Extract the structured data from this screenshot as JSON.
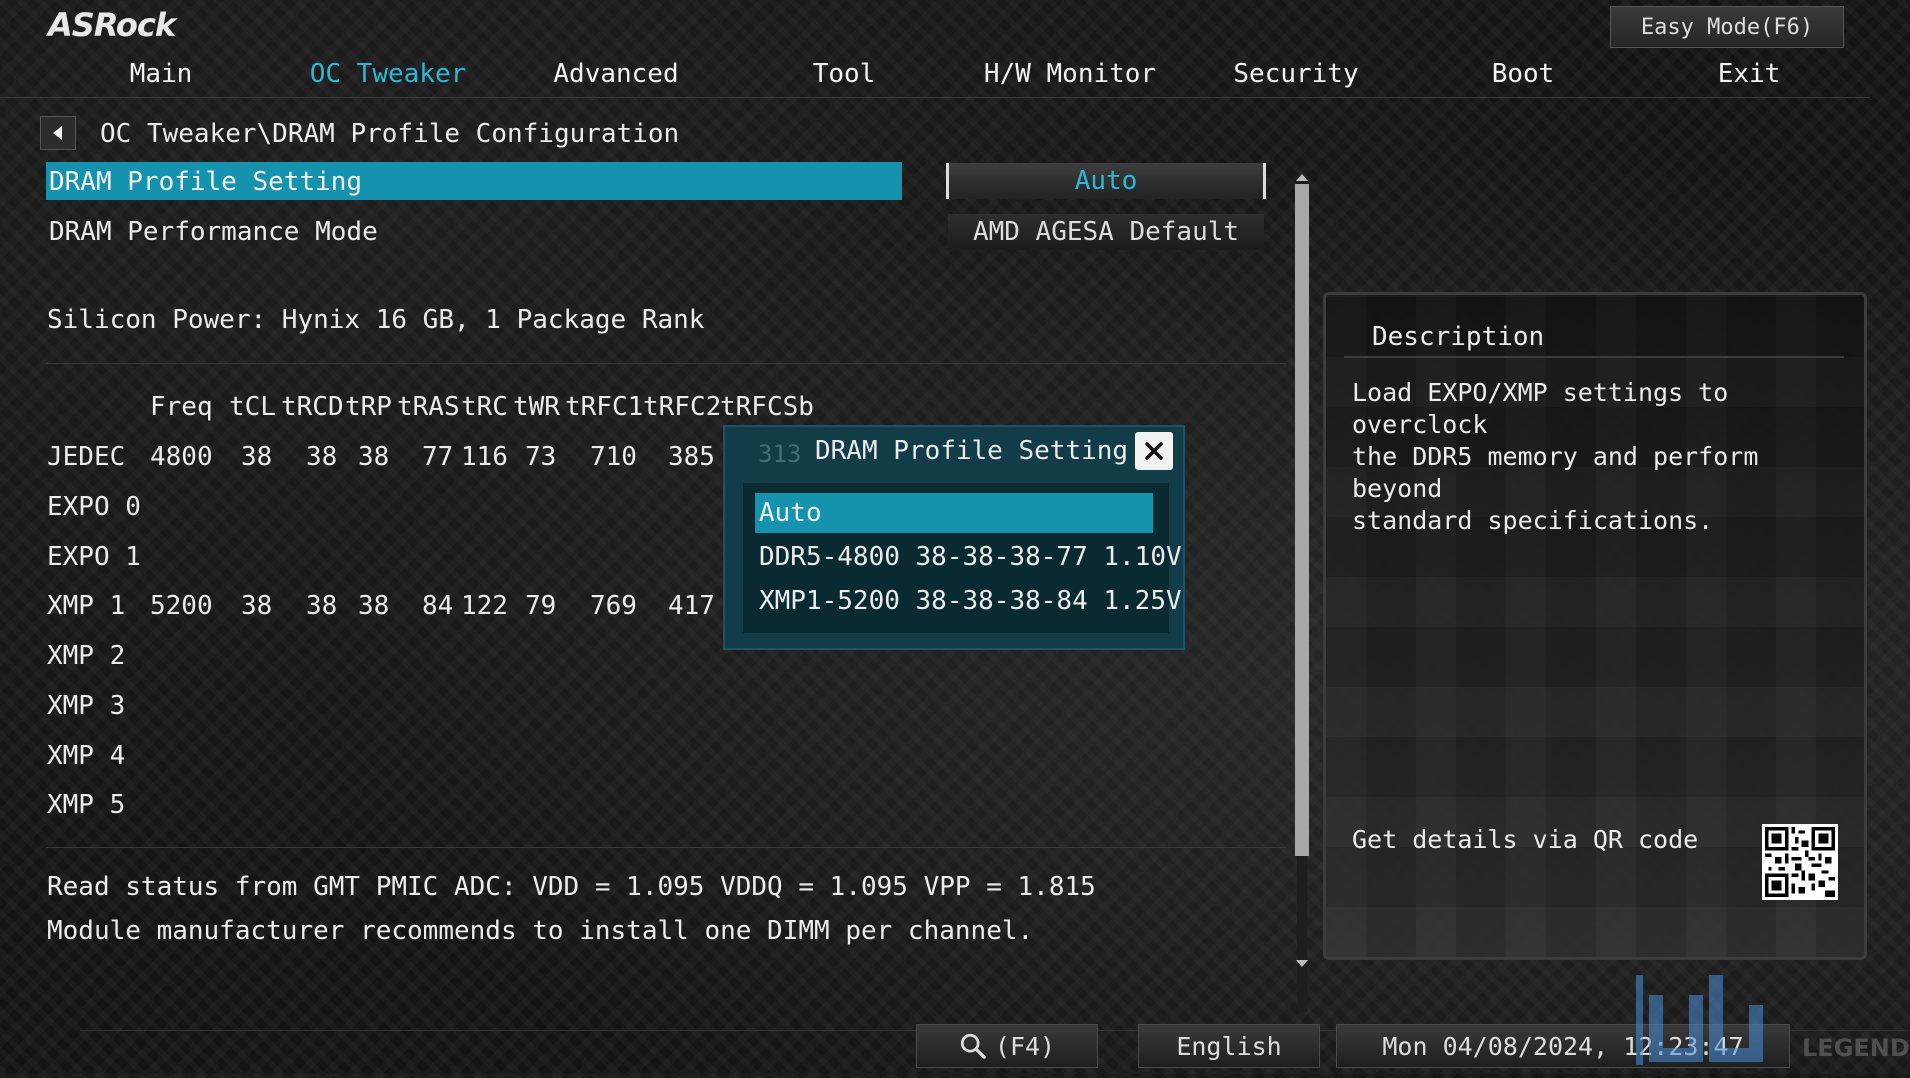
{
  "header": {
    "logo": "ASRock",
    "easy_mode": "Easy Mode(F6)"
  },
  "tabs": [
    {
      "label": "Main"
    },
    {
      "label": "OC Tweaker",
      "active": true
    },
    {
      "label": "Advanced"
    },
    {
      "label": "Tool"
    },
    {
      "label": "H/W Monitor"
    },
    {
      "label": "Security"
    },
    {
      "label": "Boot"
    },
    {
      "label": "Exit"
    }
  ],
  "breadcrumb": "OC Tweaker\\DRAM Profile Configuration",
  "settings": [
    {
      "label": "DRAM Profile Setting",
      "value": "Auto"
    },
    {
      "label": "DRAM Performance Mode",
      "value": "AMD AGESA Default"
    }
  ],
  "module_info": "Silicon Power: Hynix 16 GB, 1 Package Rank",
  "timings": {
    "headers": [
      "Freq",
      "tCL",
      "tRCD",
      "tRP",
      "tRAS",
      "tRC",
      "tWR",
      "tRFC1",
      "tRFC2",
      "tRFCSb"
    ],
    "rows": [
      {
        "name": "JEDEC",
        "values": [
          "4800",
          "38",
          "38",
          "38",
          "77",
          "116",
          "73",
          "710",
          "385",
          "313"
        ]
      },
      {
        "name": "EXPO 0",
        "values": []
      },
      {
        "name": "EXPO 1",
        "values": []
      },
      {
        "name": "XMP 1",
        "values": [
          "5200",
          "38",
          "38",
          "38",
          "84",
          "122",
          "79",
          "769",
          "417",
          ""
        ]
      },
      {
        "name": "XMP 2",
        "values": []
      },
      {
        "name": "XMP 3",
        "values": []
      },
      {
        "name": "XMP 4",
        "values": []
      },
      {
        "name": "XMP 5",
        "values": []
      }
    ]
  },
  "status": {
    "line1": "Read status from GMT PMIC ADC: VDD = 1.095 VDDQ = 1.095 VPP = 1.815",
    "line2": "Module manufacturer recommends to install one DIMM per channel."
  },
  "modal": {
    "title": "DRAM Profile Setting",
    "options": [
      "Auto",
      "DDR5-4800 38-38-38-77 1.10V",
      "XMP1-5200 38-38-38-84 1.25V"
    ],
    "selected_index": 0
  },
  "description": {
    "title": "Description",
    "text": "Load EXPO/XMP settings to overclock\nthe DDR5 memory and perform beyond\nstandard specifications.",
    "qr_label": "Get details via QR code"
  },
  "footer": {
    "search": "(F4)",
    "language": "English",
    "datetime": "Mon 04/08/2024, 12:23:47"
  },
  "watermark": {
    "text": "LEGEND"
  },
  "colors": {
    "accent": "#2ab8d8",
    "highlight": "#1592ad",
    "modal_bg": "#123c48"
  },
  "icons": [
    "back-arrow-icon",
    "close-icon",
    "search-icon",
    "qr-code-icon",
    "scroll-up-icon",
    "scroll-down-icon"
  ]
}
